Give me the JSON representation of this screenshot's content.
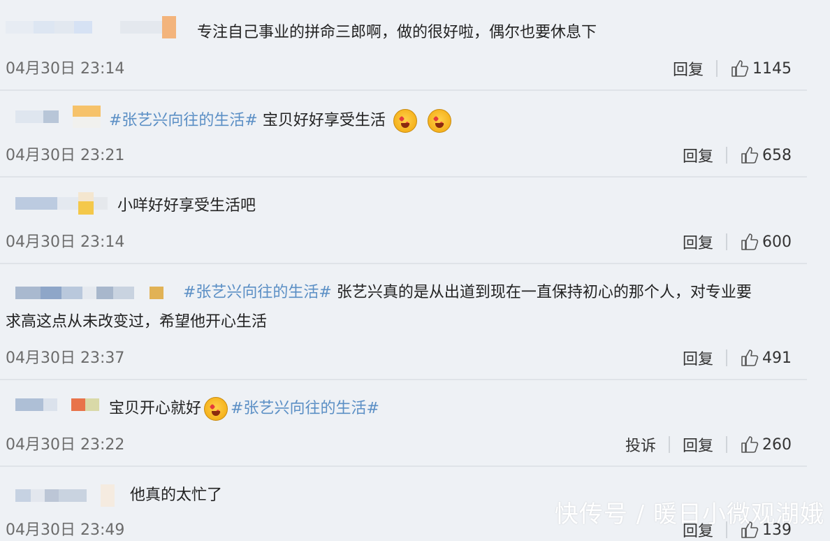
{
  "comments": [
    {
      "topic": "",
      "text": "专注自己事业的拼命三郎啊，做的很好啦，偶尔也要休息下",
      "time": "04月30日 23:14",
      "reply": "回复",
      "likes": "1145",
      "emoji_count": 0
    },
    {
      "topic": "#张艺兴向往的生活#",
      "text": " 宝贝好好享受生活",
      "time": "04月30日 23:21",
      "reply": "回复",
      "likes": "658",
      "emoji_count": 2
    },
    {
      "topic": "",
      "text": "小咩好好享受生活吧",
      "time": "04月30日 23:14",
      "reply": "回复",
      "likes": "600",
      "emoji_count": 0
    },
    {
      "topic": "#张艺兴向往的生活#",
      "text": " 张艺兴真的是从出道到现在一直保持初心的那个人，对专业要",
      "text2": "求高这点从未改变过，希望他开心生活",
      "time": "04月30日 23:37",
      "reply": "回复",
      "likes": "491"
    },
    {
      "text": "宝贝开心就好",
      "topic": "#张艺兴向往的生活#",
      "time": "04月30日 23:22",
      "report": "投诉",
      "reply": "回复",
      "likes": "260"
    },
    {
      "text": "他真的太忙了",
      "time": "04月30日 23:49",
      "reply": "回复",
      "likes": "139"
    }
  ],
  "watermark": "快传号 / 暖日小微观湖娥",
  "icons": {
    "like": "thumbs-up-icon",
    "emoji": "heart-eyes-emoji-icon"
  },
  "colors": {
    "topic": "#5b8fc5",
    "background": "#eef1f5",
    "time": "#6b6b6b"
  }
}
